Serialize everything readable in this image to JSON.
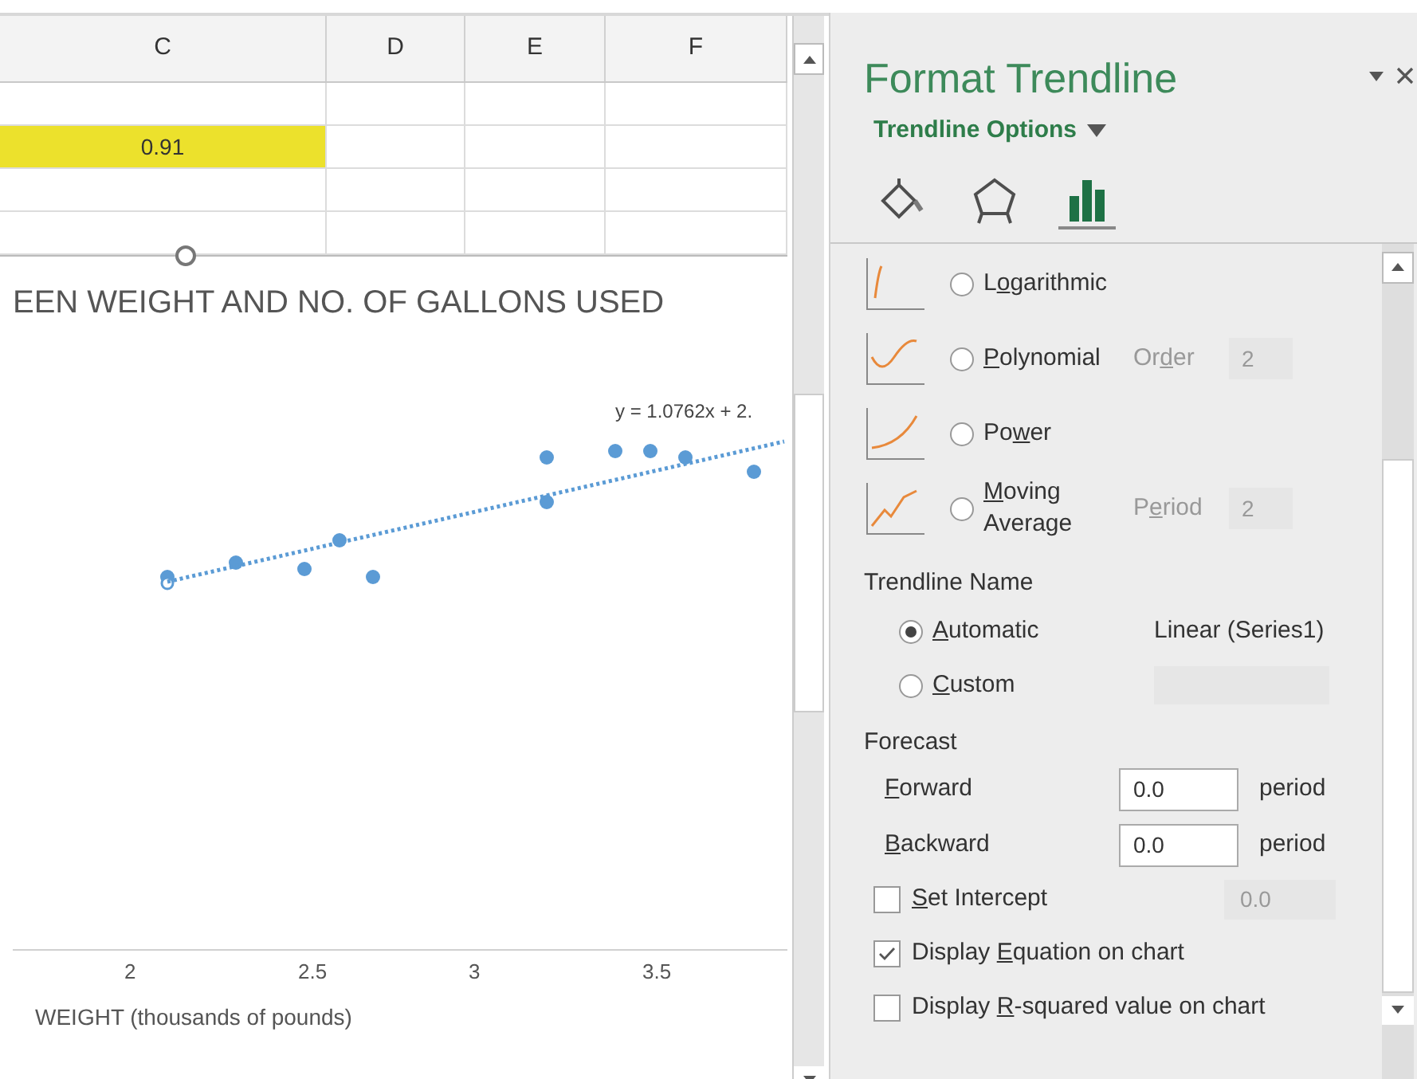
{
  "sheet": {
    "columns": [
      "C",
      "D",
      "E",
      "F"
    ],
    "rows": [
      [
        {
          "highlighted": false
        },
        {
          "highlighted": false
        },
        {
          "highlighted": false
        },
        {
          "highlighted": false
        }
      ],
      [
        {
          "text": "0.91",
          "highlighted": true
        },
        {
          "highlighted": false
        },
        {
          "highlighted": false
        },
        {
          "highlighted": false
        }
      ],
      [
        {
          "highlighted": false
        },
        {
          "highlighted": false
        },
        {
          "highlighted": false
        },
        {
          "highlighted": false
        }
      ],
      [
        {
          "highlighted": false
        },
        {
          "highlighted": false
        },
        {
          "highlighted": false
        },
        {
          "highlighted": false
        }
      ]
    ]
  },
  "chart": {
    "title": "EEN WEIGHT AND NO. OF GALLONS USED",
    "equation": "y = 1.0762x + 2.",
    "x_tick_labels": [
      "2",
      "2.5",
      "3",
      "3.5"
    ],
    "xlabel": "WEIGHT (thousands of pounds)"
  },
  "pane": {
    "title": "Format Trendline",
    "section": "Trendline Options",
    "tabs": [
      {
        "kind": "fill",
        "selected": false
      },
      {
        "kind": "effects",
        "selected": false
      },
      {
        "kind": "options",
        "selected": true
      }
    ],
    "trend_types": [
      {
        "kind": "log",
        "label": {
          "before": "L",
          "key": "o",
          "after": "garithmic"
        },
        "selected": false
      },
      {
        "kind": "poly",
        "label": {
          "key": "P",
          "after": "olynomial"
        },
        "selected": false,
        "param_label": {
          "before": "Or",
          "key": "d",
          "after": "er"
        },
        "param_value": "2"
      },
      {
        "kind": "power",
        "label": {
          "before": "Po",
          "key": "w",
          "after": "er"
        },
        "selected": false
      },
      {
        "kind": "moving",
        "label": {
          "key": "M",
          "after": "oving Average"
        },
        "selected": false,
        "param_label": {
          "before": "P",
          "key": "e",
          "after": "riod"
        },
        "param_value": "2"
      }
    ],
    "name_heading": "Trendline Name",
    "name_options": [
      {
        "label": {
          "key": "A",
          "after": "utomatic"
        },
        "selected": true,
        "value": "Linear (Series1)"
      },
      {
        "label": {
          "key": "C",
          "after": "ustom"
        },
        "selected": false
      }
    ],
    "forecast_heading": "Forecast",
    "forecast": [
      {
        "label": {
          "key": "F",
          "after": "orward"
        },
        "value": "0.0",
        "unit": "period"
      },
      {
        "label": {
          "key": "B",
          "after": "ackward"
        },
        "value": "0.0",
        "unit": "period"
      }
    ],
    "checks": [
      {
        "label": {
          "key": "S",
          "after": "et Intercept"
        },
        "checked": false,
        "value": "0.0"
      },
      {
        "label": {
          "before": "Display ",
          "key": "E",
          "after": "quation on chart"
        },
        "checked": true
      },
      {
        "label": {
          "before": "Display ",
          "key": "R",
          "after": "-squared value on chart"
        },
        "checked": false
      }
    ]
  }
}
